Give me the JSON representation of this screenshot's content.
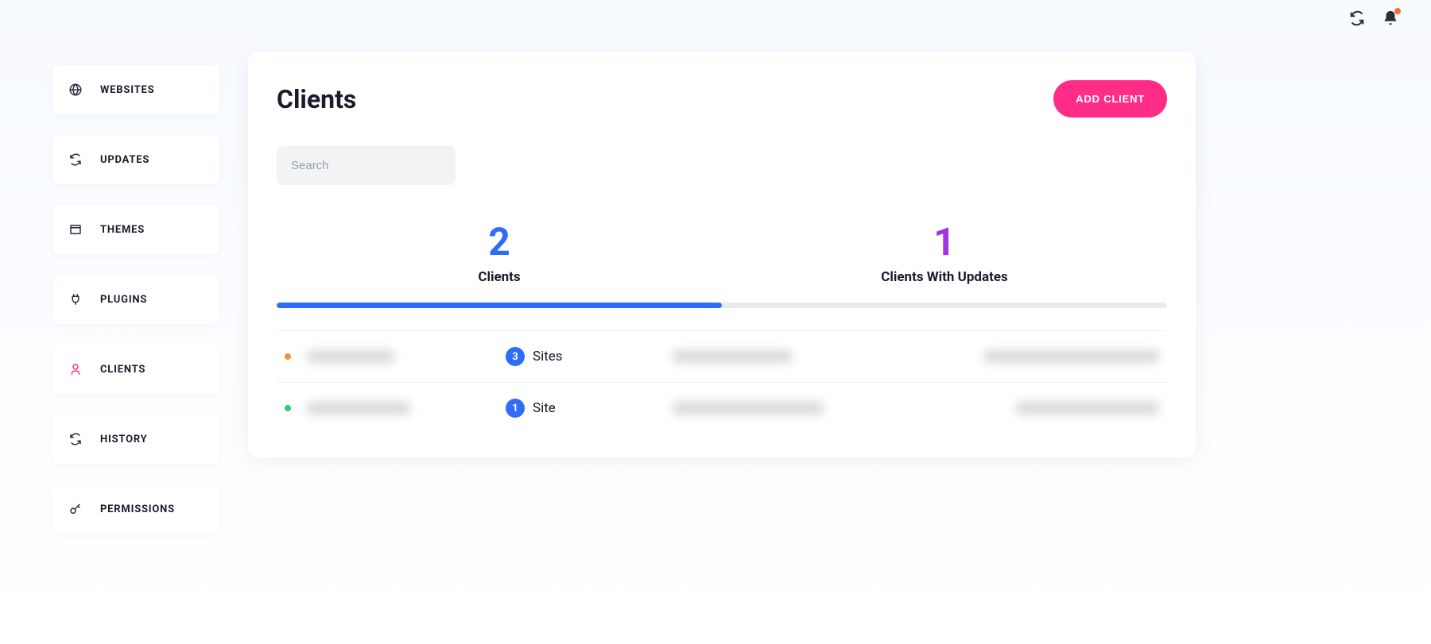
{
  "topbar": {
    "refresh_icon": "refresh",
    "bell_icon": "bell",
    "has_notification": true
  },
  "sidebar": {
    "items": [
      {
        "icon": "globe",
        "label": "WEBSITES",
        "active": false
      },
      {
        "icon": "refresh",
        "label": "UPDATES",
        "active": false
      },
      {
        "icon": "window",
        "label": "THEMES",
        "active": false
      },
      {
        "icon": "plug",
        "label": "PLUGINS",
        "active": false
      },
      {
        "icon": "user",
        "label": "CLIENTS",
        "active": true
      },
      {
        "icon": "refresh",
        "label": "HISTORY",
        "active": false
      },
      {
        "icon": "key",
        "label": "PERMISSIONS",
        "active": false
      }
    ]
  },
  "page": {
    "title": "Clients",
    "add_button": "ADD CLIENT",
    "search_placeholder": "Search"
  },
  "stats": {
    "clients": {
      "value": "2",
      "label": "Clients"
    },
    "with_updates": {
      "value": "1",
      "label": "Clients With Updates"
    },
    "progress_percent": 50
  },
  "rows": [
    {
      "status": "orange",
      "name": "██████",
      "sites_count": "3",
      "sites_label": "Sites",
      "company": "██████████",
      "email": "████████████████"
    },
    {
      "status": "green",
      "name": "███████",
      "sites_count": "1",
      "sites_label": "Site",
      "company": "████████████",
      "email": "█████████████"
    }
  ]
}
